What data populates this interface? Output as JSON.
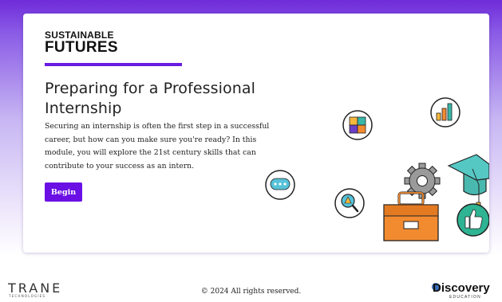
{
  "brand": {
    "line1": "SUSTAINABLE",
    "line2": "FUTURES"
  },
  "hero": {
    "title": "Preparing for a Professional Internship",
    "body": "Securing an internship is often the first step in a successful career, but how can you make sure you're ready? In this module, you will explore the 21st century skills that can contribute to your success as an intern.",
    "begin_label": "Begin"
  },
  "colors": {
    "accent": "#6a10e4",
    "bar": "#6a1be0"
  },
  "icons": [
    "puzzle-icon",
    "bar-chart-icon",
    "chat-bubble-icon",
    "magnifier-warning-icon",
    "gear-icon",
    "graduation-cap-icon",
    "briefcase-icon",
    "thumbs-up-icon"
  ],
  "footer": {
    "left_logo": "TRANE",
    "left_logo_sub": "TECHNOLOGIES",
    "copyright": "© 2024 All rights reserved.",
    "right_logo": "Discovery",
    "right_logo_sub": "EDUCATION"
  }
}
